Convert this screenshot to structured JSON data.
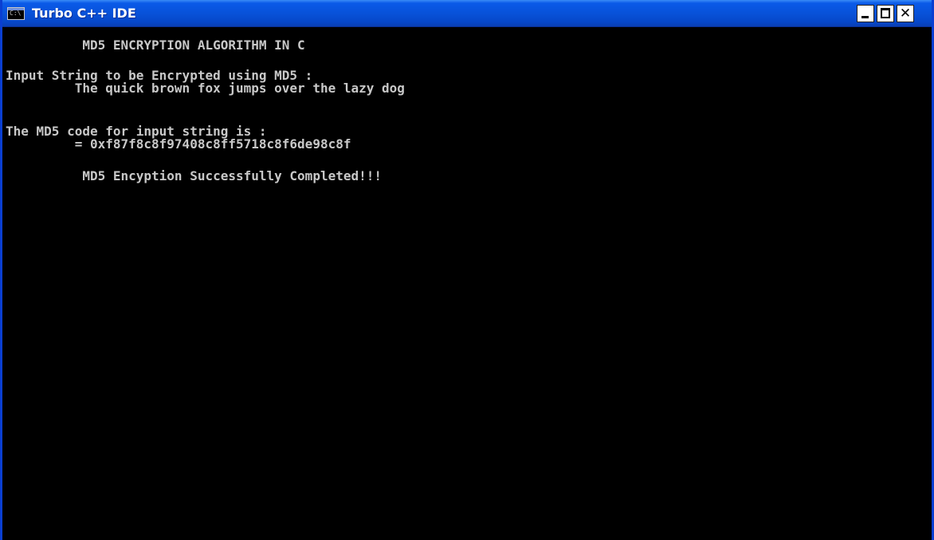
{
  "window": {
    "title": "Turbo C++ IDE",
    "icon": "console-icon",
    "icon_text": "C:\\",
    "controls": {
      "minimize": "minimize-icon",
      "maximize": "maximize-icon",
      "close": "close-icon",
      "close_glyph": "✕"
    }
  },
  "console": {
    "lines": [
      "          MD5 ENCRYPTION ALGORITHM IN C",
      "Input String to be Encrypted using MD5 :",
      "         The quick brown fox jumps over the lazy dog",
      "The MD5 code for input string is :",
      "         = 0xf87f8c8f97408c8ff5718c8f6de98c8f",
      "          MD5 Encyption Successfully Completed!!!"
    ]
  },
  "colors": {
    "titlebar": "#0852d9",
    "console_background": "#000000",
    "console_text": "#c8c8c8"
  }
}
